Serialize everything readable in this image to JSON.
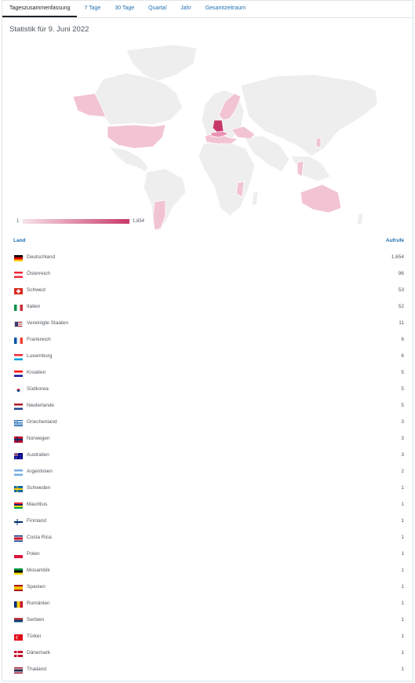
{
  "tabs": [
    "Tageszusammenfassung",
    "7 Tage",
    "30 Tage",
    "Quartal",
    "Jahr",
    "Gesamtzeitraum"
  ],
  "title": "Statistik für 9. Juni 2022",
  "legend": {
    "min": "1",
    "max": "1,654",
    "color_low": "#f7e3ea",
    "color_high": "#c8396b"
  },
  "table": {
    "col_country": "Land",
    "col_views": "Aufrufe",
    "rows": [
      {
        "country": "Deutschland",
        "views": "1,654",
        "flag": "de-flag-icon"
      },
      {
        "country": "Österreich",
        "views": "96",
        "flag": "at-flag-icon"
      },
      {
        "country": "Schweiz",
        "views": "53",
        "flag": "ch-flag-icon"
      },
      {
        "country": "Italien",
        "views": "52",
        "flag": "it-flag-icon"
      },
      {
        "country": "Vereinigte Staaten",
        "views": "11",
        "flag": "us-flag-icon"
      },
      {
        "country": "Frankreich",
        "views": "6",
        "flag": "fr-flag-icon"
      },
      {
        "country": "Luxemburg",
        "views": "6",
        "flag": "lu-flag-icon"
      },
      {
        "country": "Kroatien",
        "views": "5",
        "flag": "hr-flag-icon"
      },
      {
        "country": "Südkorea",
        "views": "5",
        "flag": "kr-flag-icon"
      },
      {
        "country": "Niederlande",
        "views": "5",
        "flag": "nl-flag-icon"
      },
      {
        "country": "Griechenland",
        "views": "3",
        "flag": "gr-flag-icon"
      },
      {
        "country": "Norwegen",
        "views": "3",
        "flag": "no-flag-icon"
      },
      {
        "country": "Australien",
        "views": "3",
        "flag": "au-flag-icon"
      },
      {
        "country": "Argentinien",
        "views": "2",
        "flag": "ar-flag-icon"
      },
      {
        "country": "Schweden",
        "views": "1",
        "flag": "se-flag-icon"
      },
      {
        "country": "Mauritius",
        "views": "1",
        "flag": "mu-flag-icon"
      },
      {
        "country": "Finnland",
        "views": "1",
        "flag": "fi-flag-icon"
      },
      {
        "country": "Costa Rica",
        "views": "1",
        "flag": "cr-flag-icon"
      },
      {
        "country": "Polen",
        "views": "1",
        "flag": "pl-flag-icon"
      },
      {
        "country": "Mosambik",
        "views": "1",
        "flag": "mz-flag-icon"
      },
      {
        "country": "Spanien",
        "views": "1",
        "flag": "es-flag-icon"
      },
      {
        "country": "Rumänien",
        "views": "1",
        "flag": "ro-flag-icon"
      },
      {
        "country": "Serbien",
        "views": "1",
        "flag": "rs-flag-icon"
      },
      {
        "country": "Türkei",
        "views": "1",
        "flag": "tr-flag-icon"
      },
      {
        "country": "Dänemark",
        "views": "1",
        "flag": "dk-flag-icon"
      },
      {
        "country": "Thailand",
        "views": "1",
        "flag": "th-flag-icon"
      }
    ]
  }
}
